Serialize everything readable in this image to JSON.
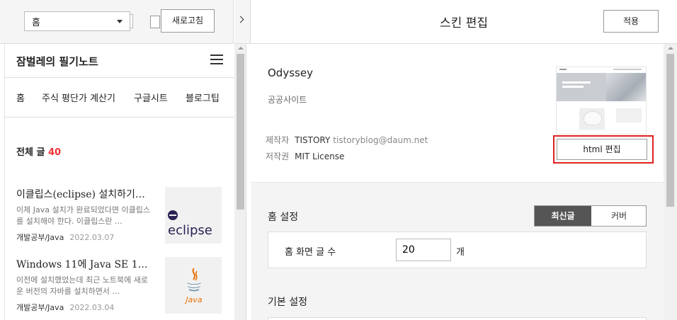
{
  "toolbar": {
    "page_select": "홈",
    "refresh_label": "새로고침"
  },
  "blog": {
    "title": "잠벌레의 필기노트",
    "nav": [
      "홈",
      "주식 평단가 계산기",
      "구글시트",
      "블로그팁"
    ],
    "total_label": "전체 글",
    "total_count": "40",
    "posts": [
      {
        "title": "이클립스(eclipse) 설치하기…",
        "excerpt": "이제 Java 설치가 완료되었다면 이클립스를 설치해야 한다. 이클립스란 …",
        "category": "개발공부/Java",
        "date": "2022.03.07",
        "thumb_icon": "eclipse-logo",
        "thumb_text": "eclipse"
      },
      {
        "title": "Windows 11에 Java SE 1…",
        "excerpt": "이전에 설치했었는데 최근 노트북에 새로운 버전의 자바를 설치하면서 …",
        "category": "개발공부/Java",
        "date": "2022.03.04",
        "thumb_icon": "java-logo",
        "thumb_text": "Java"
      }
    ]
  },
  "editor": {
    "title": "스킨 편집",
    "apply_label": "적용",
    "skin": {
      "name": "Odyssey",
      "description": "공공사이트",
      "maker_label": "제작자",
      "maker": "TISTORY",
      "maker_email": "tistoryblog@daum.net",
      "license_label": "저작권",
      "license": "MIT License",
      "html_edit_label": "html 편집"
    },
    "home_settings": {
      "title": "홈 설정",
      "option_latest": "최신글",
      "option_cover": "커버",
      "post_count_label": "홈 화면 글 수",
      "post_count_value": "20",
      "post_count_unit": "개"
    },
    "basic_settings": {
      "title": "기본 설정"
    }
  },
  "colors": {
    "highlight_border": "#e02020",
    "count_red": "#e33333",
    "segment_active": "#555555"
  }
}
